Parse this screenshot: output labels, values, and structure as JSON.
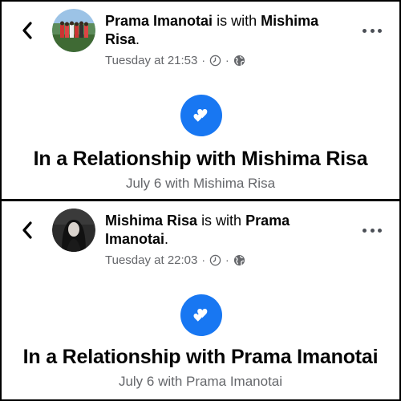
{
  "posts": [
    {
      "author": "Prama Imanotai",
      "connector": "is with",
      "partner": "Mishima",
      "partner_line2": "Risa",
      "period": ".",
      "timestamp": "Tuesday at 21:53",
      "relationship_title": "In a Relationship with Mishima Risa",
      "relationship_sub": "July 6 with Mishima Risa"
    },
    {
      "author": "Mishima Risa",
      "connector": "is with",
      "partner": "Prama",
      "partner_line2": "Imanotai",
      "period": ".",
      "timestamp": "Tuesday at 22:03",
      "relationship_title": "In a Relationship with Prama Imanotai",
      "relationship_sub": "July 6 with Prama Imanotai"
    }
  ],
  "separator": "·",
  "colors": {
    "accent": "#1877f2",
    "secondary_text": "#65676b",
    "primary_text": "#050505"
  },
  "icons": [
    "back-chevron-icon",
    "clock-icon",
    "globe-icon",
    "more-icon",
    "heart-icon"
  ]
}
